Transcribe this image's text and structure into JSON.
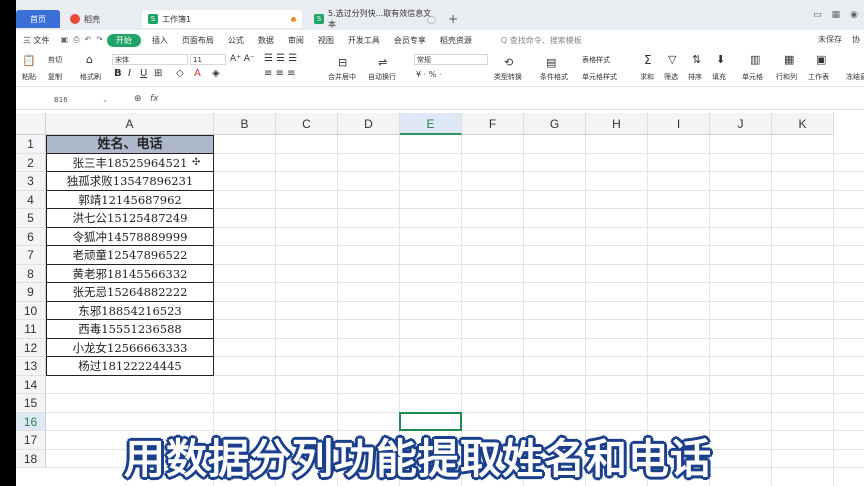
{
  "tabs": {
    "home": "首页",
    "t1": "稻壳",
    "t2": "工作簿1",
    "t3": "5.选过分列快...取有效信息文本"
  },
  "menu": {
    "file": "三 文件",
    "start": "开始",
    "items": [
      "插入",
      "页面布局",
      "公式",
      "数据",
      "审阅",
      "视图",
      "开发工具",
      "会员专享",
      "稻壳资源"
    ],
    "search": "Q 查找命令、搜索模板",
    "right": [
      "未保存",
      "协"
    ]
  },
  "ribbon": {
    "paste": "粘贴",
    "cut": "剪切",
    "copy": "复制",
    "format_painter": "格式刷",
    "font_name": "宋体",
    "font_size": "11",
    "bold": "B",
    "italic": "I",
    "underline": "U",
    "merge": "合并居中",
    "wrap": "自动换行",
    "number_format": "常规",
    "percent": "¥ · % ·",
    "type_convert": "类型转换",
    "cond_format": "条件格式",
    "table_style": "表格样式",
    "cell_style": "单元格样式",
    "sum": "求和",
    "filter": "筛选",
    "sort": "排序",
    "fill": "填充",
    "cell": "单元格",
    "rowcol": "行和列",
    "sheet": "工作表",
    "freeze": "冻结窗"
  },
  "formula_bar": {
    "name_box": "B16",
    "fx": "fx",
    "value": ""
  },
  "columns": [
    "A",
    "B",
    "C",
    "D",
    "E",
    "F",
    "G",
    "H",
    "I",
    "J",
    "K"
  ],
  "selected_column": "E",
  "rows": [
    "1",
    "2",
    "3",
    "4",
    "5",
    "6",
    "7",
    "8",
    "9",
    "10",
    "11",
    "12",
    "13",
    "14",
    "15",
    "16",
    "17",
    "18"
  ],
  "selected_row": "16",
  "header_cell": "姓名、电话",
  "data_cells": [
    "张三丰18525964521",
    "独孤求败13547896231",
    "郭靖12145687962",
    "洪七公15125487249",
    "令狐冲14578889999",
    "老顽童12547896522",
    "黄老邪18145566332",
    "张无忌15264882222",
    "东邪18854216523",
    "西毒15551236588",
    "小龙女12566663333",
    "杨过18122224445"
  ],
  "caption": "用数据分列功能提取姓名和电话",
  "colors": {
    "accent_green": "#20a467",
    "header_fill": "#adb9ca",
    "selection": "#1f8a54",
    "caption_outline": "#1b3f8b"
  }
}
